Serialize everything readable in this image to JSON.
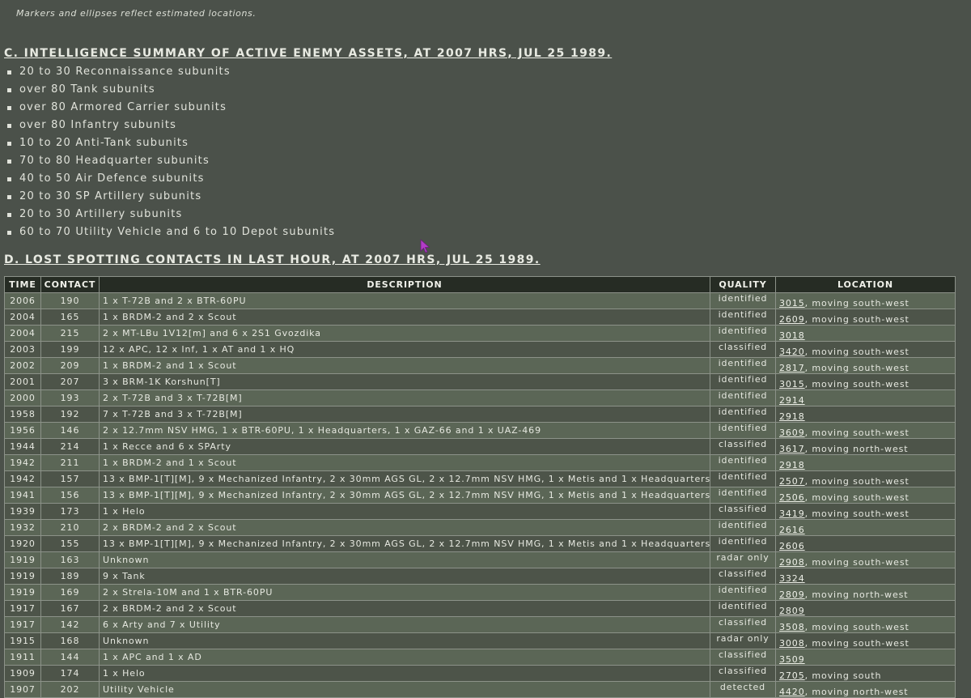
{
  "note": "Markers and ellipses reflect estimated locations.",
  "section_c": {
    "title": "C. INTELLIGENCE SUMMARY OF ACTIVE ENEMY ASSETS, AT 2007 HRS, JUL 25 1989.",
    "items": [
      "20 to 30 Reconnaissance subunits",
      "over 80 Tank subunits",
      "over 80 Armored Carrier subunits",
      "over 80 Infantry subunits",
      "10 to 20 Anti-Tank subunits",
      "70 to 80 Headquarter subunits",
      "40 to 50 Air Defence subunits",
      "20 to 30 SP Artillery subunits",
      "20 to 30 Artillery subunits",
      "60 to 70 Utility Vehicle and 6 to 10 Depot subunits"
    ]
  },
  "section_d": {
    "title": "D. LOST SPOTTING CONTACTS IN LAST HOUR, AT 2007 HRS, JUL 25 1989.",
    "columns": {
      "time": "TIME",
      "contact": "CONTACT",
      "description": "DESCRIPTION",
      "quality": "QUALITY",
      "location": "LOCATION"
    },
    "rows": [
      {
        "time": "2006",
        "contact": "190",
        "description": "1 x T-72B and 2 x BTR-60PU",
        "quality": "identified",
        "grid": "3015",
        "movement": ", moving south-west"
      },
      {
        "time": "2004",
        "contact": "165",
        "description": "1 x BRDM-2 and 2 x Scout",
        "quality": "identified",
        "grid": "2609",
        "movement": ", moving south-west"
      },
      {
        "time": "2004",
        "contact": "215",
        "description": "2 x MT-LBu 1V12[m] and 6 x 2S1 Gvozdika",
        "quality": "identified",
        "grid": "3018",
        "movement": ""
      },
      {
        "time": "2003",
        "contact": "199",
        "description": "12 x APC, 12 x Inf, 1 x AT and 1 x HQ",
        "quality": "classified",
        "grid": "3420",
        "movement": ", moving south-west"
      },
      {
        "time": "2002",
        "contact": "209",
        "description": "1 x BRDM-2 and 1 x Scout",
        "quality": "identified",
        "grid": "2817",
        "movement": ", moving south-west"
      },
      {
        "time": "2001",
        "contact": "207",
        "description": "3 x BRM-1K Korshun[T]",
        "quality": "identified",
        "grid": "3015",
        "movement": ", moving south-west"
      },
      {
        "time": "2000",
        "contact": "193",
        "description": "2 x T-72B and 3 x T-72B[M]",
        "quality": "identified",
        "grid": "2914",
        "movement": ""
      },
      {
        "time": "1958",
        "contact": "192",
        "description": "7 x T-72B and 3 x T-72B[M]",
        "quality": "identified",
        "grid": "2918",
        "movement": ""
      },
      {
        "time": "1956",
        "contact": "146",
        "description": "2 x 12.7mm NSV HMG, 1 x BTR-60PU, 1 x Headquarters, 1 x GAZ-66 and 1 x UAZ-469",
        "quality": "identified",
        "grid": "3609",
        "movement": ", moving south-west"
      },
      {
        "time": "1944",
        "contact": "214",
        "description": "1 x Recce and 6 x SPArty",
        "quality": "classified",
        "grid": "3617",
        "movement": ", moving north-west"
      },
      {
        "time": "1942",
        "contact": "211",
        "description": "1 x BRDM-2 and 1 x Scout",
        "quality": "identified",
        "grid": "2918",
        "movement": ""
      },
      {
        "time": "1942",
        "contact": "157",
        "description": "13 x BMP-1[T][M], 9 x Mechanized Infantry, 2 x 30mm AGS GL, 2 x 12.7mm NSV HMG, 1 x Metis and 1 x Headquarters",
        "quality": "identified",
        "grid": "2507",
        "movement": ", moving south-west"
      },
      {
        "time": "1941",
        "contact": "156",
        "description": "13 x BMP-1[T][M], 9 x Mechanized Infantry, 2 x 30mm AGS GL, 2 x 12.7mm NSV HMG, 1 x Metis and 1 x Headquarters",
        "quality": "identified",
        "grid": "2506",
        "movement": ", moving south-west"
      },
      {
        "time": "1939",
        "contact": "173",
        "description": "1 x Helo",
        "quality": "classified",
        "grid": "3419",
        "movement": ", moving south-west"
      },
      {
        "time": "1932",
        "contact": "210",
        "description": "2 x BRDM-2 and 2 x Scout",
        "quality": "identified",
        "grid": "2616",
        "movement": ""
      },
      {
        "time": "1920",
        "contact": "155",
        "description": "13 x BMP-1[T][M], 9 x Mechanized Infantry, 2 x 30mm AGS GL, 2 x 12.7mm NSV HMG, 1 x Metis and 1 x Headquarters",
        "quality": "identified",
        "grid": "2606",
        "movement": ""
      },
      {
        "time": "1919",
        "contact": "163",
        "description": "Unknown",
        "quality": "radar only",
        "grid": "2908",
        "movement": ", moving south-west"
      },
      {
        "time": "1919",
        "contact": "189",
        "description": "9 x Tank",
        "quality": "classified",
        "grid": "3324",
        "movement": ""
      },
      {
        "time": "1919",
        "contact": "169",
        "description": "2 x Strela-10M and 1 x BTR-60PU",
        "quality": "identified",
        "grid": "2809",
        "movement": ", moving north-west"
      },
      {
        "time": "1917",
        "contact": "167",
        "description": "2 x BRDM-2 and 2 x Scout",
        "quality": "identified",
        "grid": "2809",
        "movement": ""
      },
      {
        "time": "1917",
        "contact": "142",
        "description": "6 x Arty and 7 x Utility",
        "quality": "classified",
        "grid": "3508",
        "movement": ", moving south-west"
      },
      {
        "time": "1915",
        "contact": "168",
        "description": "Unknown",
        "quality": "radar only",
        "grid": "3008",
        "movement": ", moving south-west"
      },
      {
        "time": "1911",
        "contact": "144",
        "description": "1 x APC and 1 x AD",
        "quality": "classified",
        "grid": "3509",
        "movement": ""
      },
      {
        "time": "1909",
        "contact": "174",
        "description": "1 x Helo",
        "quality": "classified",
        "grid": "2705",
        "movement": ", moving south"
      },
      {
        "time": "1907",
        "contact": "202",
        "description": "Utility Vehicle",
        "quality": "detected",
        "grid": "4420",
        "movement": ", moving north-west"
      }
    ]
  },
  "colors": {
    "background": "#4b514a",
    "header_bg": "#262c24",
    "row_light": "#5b6656",
    "row_dark": "#4d5449",
    "cursor": "#b23cc8"
  },
  "icons": {
    "cursor": "mouse-pointer-icon"
  }
}
